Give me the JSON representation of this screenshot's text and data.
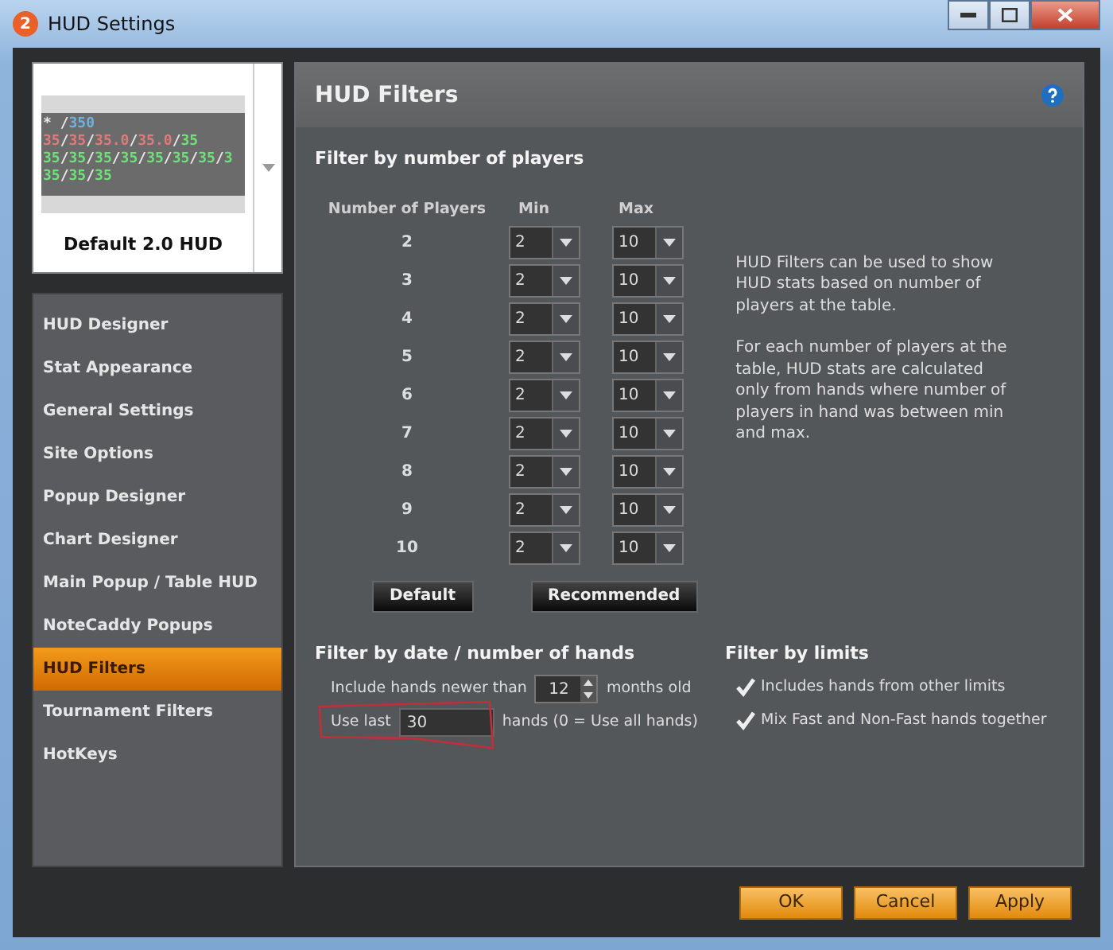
{
  "window": {
    "title": "HUD Settings",
    "app_badge": "2"
  },
  "hud_preview": {
    "name": "Default 2.0 HUD",
    "lines": [
      [
        {
          "text": "*",
          "color": "#e8e8e8"
        },
        {
          "text": " /",
          "color": "#e8e8e8"
        },
        {
          "text": "350",
          "color": "#6fb3e0"
        }
      ],
      [
        {
          "text": "35",
          "color": "#e07a7a"
        },
        {
          "text": "/",
          "color": "#e8e8e8"
        },
        {
          "text": "35",
          "color": "#e07a7a"
        },
        {
          "text": "/",
          "color": "#e8e8e8"
        },
        {
          "text": "35.0",
          "color": "#e07a7a"
        },
        {
          "text": "/",
          "color": "#e8e8e8"
        },
        {
          "text": "35.0",
          "color": "#e07a7a"
        },
        {
          "text": "/",
          "color": "#e8e8e8"
        },
        {
          "text": "35",
          "color": "#6fe07a"
        }
      ],
      [
        {
          "text": "35",
          "color": "#6fe07a"
        },
        {
          "text": "/",
          "color": "#e8e8e8"
        },
        {
          "text": "35",
          "color": "#6fe07a"
        },
        {
          "text": "/",
          "color": "#e8e8e8"
        },
        {
          "text": "35",
          "color": "#6fe07a"
        },
        {
          "text": "/",
          "color": "#e8e8e8"
        },
        {
          "text": "35",
          "color": "#6fe07a"
        },
        {
          "text": "/",
          "color": "#e8e8e8"
        },
        {
          "text": "35",
          "color": "#6fe07a"
        },
        {
          "text": "/",
          "color": "#e8e8e8"
        },
        {
          "text": "35",
          "color": "#6fe07a"
        },
        {
          "text": "/",
          "color": "#e8e8e8"
        },
        {
          "text": "35",
          "color": "#6fe07a"
        },
        {
          "text": "/",
          "color": "#e8e8e8"
        },
        {
          "text": "3",
          "color": "#6fe07a"
        }
      ],
      [
        {
          "text": "35",
          "color": "#6fe07a"
        },
        {
          "text": "/",
          "color": "#e8e8e8"
        },
        {
          "text": "35",
          "color": "#6fe07a"
        },
        {
          "text": "/",
          "color": "#e8e8e8"
        },
        {
          "text": "35",
          "color": "#6fe07a"
        }
      ]
    ]
  },
  "sidebar": {
    "items": [
      {
        "label": "HUD Designer",
        "selected": false
      },
      {
        "label": "Stat Appearance",
        "selected": false
      },
      {
        "label": "General Settings",
        "selected": false
      },
      {
        "label": "Site Options",
        "selected": false
      },
      {
        "label": "Popup Designer",
        "selected": false
      },
      {
        "label": "Chart Designer",
        "selected": false
      },
      {
        "label": "Main Popup / Table HUD",
        "selected": false
      },
      {
        "label": "NoteCaddy Popups",
        "selected": false
      },
      {
        "label": "HUD Filters",
        "selected": true
      },
      {
        "label": "Tournament Filters",
        "selected": false
      },
      {
        "label": "HotKeys",
        "selected": false
      }
    ]
  },
  "panel": {
    "title": "HUD Filters",
    "players_section": {
      "heading": "Filter by number of players",
      "columns": [
        "Number of Players",
        "Min",
        "Max"
      ],
      "rows": [
        {
          "players": "2",
          "min": "2",
          "max": "10"
        },
        {
          "players": "3",
          "min": "2",
          "max": "10"
        },
        {
          "players": "4",
          "min": "2",
          "max": "10"
        },
        {
          "players": "5",
          "min": "2",
          "max": "10"
        },
        {
          "players": "6",
          "min": "2",
          "max": "10"
        },
        {
          "players": "7",
          "min": "2",
          "max": "10"
        },
        {
          "players": "8",
          "min": "2",
          "max": "10"
        },
        {
          "players": "9",
          "min": "2",
          "max": "10"
        },
        {
          "players": "10",
          "min": "2",
          "max": "10"
        }
      ],
      "description": [
        "HUD Filters can be used to show HUD stats based on number of players at the table.",
        "For each number of players at the table, HUD stats are calculated only from hands where number of players in hand was between min and max."
      ],
      "buttons": [
        "Default",
        "Recommended"
      ]
    },
    "date_section": {
      "heading": "Filter by date / number of hands",
      "newer_label": "Include hands newer than",
      "newer_value": "12",
      "newer_suffix": "months old",
      "last_label": "Use last",
      "last_value": "30",
      "last_suffix": "hands (0 = Use all hands)",
      "last_highlighted": true
    },
    "limits_section": {
      "heading": "Filter by limits",
      "options": [
        {
          "label": "Includes hands from other limits",
          "checked": true
        },
        {
          "label": "Mix Fast and Non-Fast hands together",
          "checked": true
        }
      ]
    }
  },
  "footer_buttons": [
    "OK",
    "Cancel",
    "Apply"
  ]
}
